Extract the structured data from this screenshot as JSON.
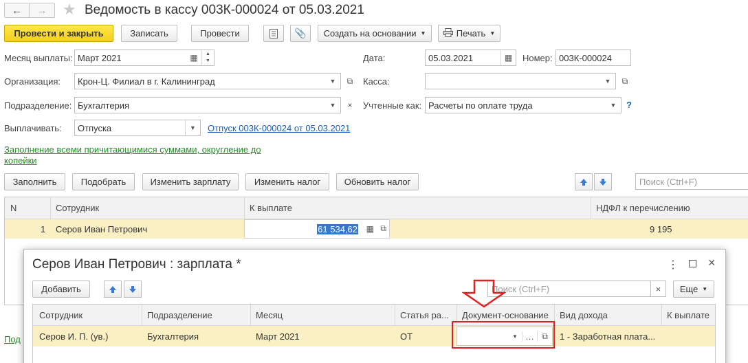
{
  "window": {
    "title": "Ведомость в кассу 003К-000024 от 05.03.2021"
  },
  "toolbar": {
    "post_close": "Провести и закрыть",
    "save": "Записать",
    "post": "Провести",
    "create_based": "Создать на основании",
    "print": "Печать"
  },
  "form": {
    "month_label": "Месяц выплаты:",
    "month_value": "Март 2021",
    "date_label": "Дата:",
    "date_value": "05.03.2021",
    "number_label": "Номер:",
    "number_value": "003К-000024",
    "org_label": "Организация:",
    "org_value": "Крон-Ц. Филиал в г. Калининград",
    "kassa_label": "Касса:",
    "kassa_value": "",
    "dept_label": "Подразделение:",
    "dept_value": "Бухгалтерия",
    "accounted_label": "Учтенные как:",
    "accounted_value": "Расчеты по оплате труда",
    "help": "?",
    "pay_label": "Выплачивать:",
    "pay_value": "Отпуска",
    "pay_link": "Отпуск 003К-000024 от 05.03.2021",
    "fill_link": "Заполнение всеми причитающимися суммами, округление до копейки"
  },
  "table_toolbar": {
    "fill": "Заполнить",
    "select": "Подобрать",
    "change_salary": "Изменить зарплату",
    "change_tax": "Изменить налог",
    "update_tax": "Обновить налог",
    "search_placeholder": "Поиск (Ctrl+F)"
  },
  "table": {
    "headers": {
      "n": "N",
      "employee": "Сотрудник",
      "to_pay": "К выплате",
      "ndfl": "НДФЛ к перечислению"
    },
    "rows": [
      {
        "n": "1",
        "employee": "Серов Иван Петрович",
        "to_pay": "61 534,62",
        "ndfl": "9 195"
      }
    ]
  },
  "bottom_left_link": "Под",
  "dialog": {
    "title": "Серов Иван Петрович : зарплата *",
    "add": "Добавить",
    "search_placeholder": "Поиск (Ctrl+F)",
    "more": "Еще",
    "headers": {
      "employee": "Сотрудник",
      "dept": "Подразделение",
      "month": "Месяц",
      "article": "Статья ра...",
      "doc_basis": "Документ-основание",
      "income_type": "Вид дохода",
      "to_pay": "К выплате"
    },
    "rows": [
      {
        "employee": "Серов И. П. (ув.)",
        "dept": "Бухгалтерия",
        "month": "Март 2021",
        "article": "ОТ",
        "doc_basis": "",
        "income_type": "1 - Заработная плата...",
        "to_pay": ""
      }
    ]
  },
  "colors": {
    "accent_yellow": "#f5d01e",
    "row_highlight": "#fbf0c4",
    "annotation_red": "#e02020",
    "link_green": "#2a8a2a",
    "link_blue": "#1a5fb4"
  }
}
